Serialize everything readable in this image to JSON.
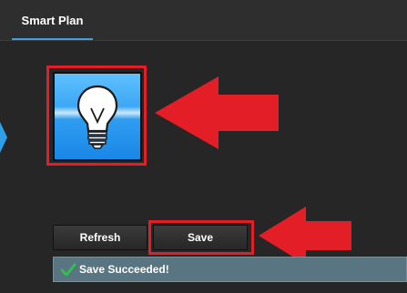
{
  "header": {
    "tabs": [
      {
        "label": "Smart Plan",
        "active": true
      }
    ]
  },
  "icon": {
    "name": "lightbulb-icon",
    "accent": "#3fa0de"
  },
  "buttons": {
    "refresh_label": "Refresh",
    "save_label": "Save"
  },
  "status": {
    "text": "Save Succeeded!",
    "state": "success",
    "color": "#2fc24a"
  },
  "annotations": {
    "highlight_color": "#e41e26"
  }
}
